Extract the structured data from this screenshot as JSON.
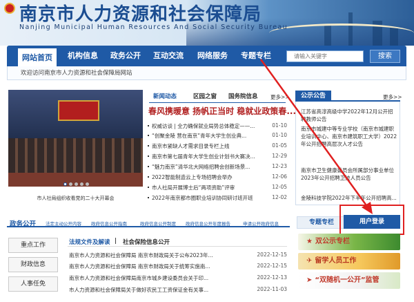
{
  "header": {
    "title_cn": "南京市人力资源和社会保障局",
    "title_en": "Nanjing Municipal Human Resources And Social Security Bureau"
  },
  "nav": {
    "items": [
      "网站首页",
      "机构信息",
      "政务公开",
      "互动交流",
      "网络服务",
      "专题专栏"
    ],
    "search_placeholder": "请输入关键字",
    "search_label": "搜索",
    "welcome": "欢迎访问南京市人力资源和社会保障局网站"
  },
  "photo": {
    "caption": "市人社局组织收看党的二十大开幕会"
  },
  "news": {
    "tabs": [
      "新闻动态",
      "区园之窗",
      "国务院信息"
    ],
    "more": "更多>>",
    "headline": "春风携暖意 扬帆正当时 稳就业政策春...",
    "items": [
      {
        "title": "权威访谈 | 全力确保就业局势总体稳定——...",
        "date": "01-10"
      },
      {
        "title": "“创聚金陵 营在南京”青年大学生创业典...",
        "date": "01-10"
      },
      {
        "title": "南京市紧缺人才需求目录专栏上线",
        "date": "01-05"
      },
      {
        "title": "南京市第七届青年大学生创业计划书大赛决...",
        "date": "12-29"
      },
      {
        "title": "“魅力南京”清华北大网络招聘会创新场景...",
        "date": "12-23"
      },
      {
        "title": "2022智能制造云上专场招聘会举办",
        "date": "12-06"
      },
      {
        "title": "市人社局开展博士后“两项资助”评审",
        "date": "12-05"
      },
      {
        "title": "2022年南京都市圈职业培训协同研讨班开班",
        "date": "12-02"
      }
    ]
  },
  "notice": {
    "title": "公示公告",
    "more": "更多>>",
    "items": [
      "江苏省高淳高级中学2022年12月公开招聘教师公告",
      "南京市城建中等专业学校（南京市城建职业培训中心、南京市建筑职工大学）2022年公开招聘高层次人才公告",
      "南京市卫生健康委员会所属部分事业单位2023年公开招聘卫技人员公告",
      "金陵科技学院2022年下半年公开招聘高..."
    ]
  },
  "gov_open": {
    "title": "政务公开",
    "links": [
      "法定主动公开内容",
      "政府信息公开指南",
      "政府信息公开制度",
      "政府信息公开年度报告",
      "申请公开政府信息"
    ],
    "side_buttons": [
      "重点工作",
      "财政信息",
      "人事任免"
    ],
    "law_tabs": [
      "法规文件及解读",
      "社会保险信息公开"
    ],
    "items": [
      {
        "title": "南京市人力资源和社会保障局 南京市财政局关于公布2023年...",
        "date": "2022-12-15"
      },
      {
        "title": "南京市人力资源和社会保障局 南京市财政局关于统筹实施南...",
        "date": "2022-12-15"
      },
      {
        "title": "南京市人力资源和社会保障局南京市城乡建设委员会关于印...",
        "date": "2022-12-13"
      },
      {
        "title": "市人力资源和社会保障局关于做好农民工工资保证金有关事...",
        "date": "2022-11-03"
      }
    ]
  },
  "right_lower": {
    "topic_tab": "专题专栏",
    "user_login": "用户登录",
    "ads": [
      "双公示专栏",
      "留学人员工作",
      "“双随机一公开”监管"
    ]
  },
  "colors": {
    "nav_blue": "#1f5aa6",
    "headline_red": "#b22222",
    "annotation_red": "#e02020"
  }
}
